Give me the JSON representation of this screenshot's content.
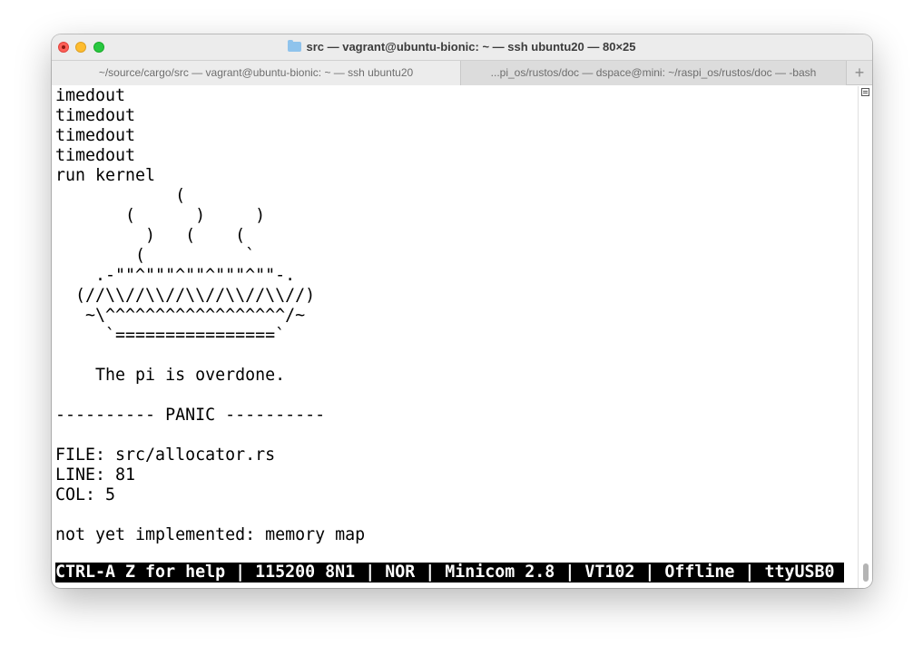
{
  "window": {
    "title": "src — vagrant@ubuntu-bionic: ~ — ssh ubuntu20 — 80×25",
    "folder_icon": "folder-icon"
  },
  "tabs": [
    {
      "label": "~/source/cargo/src — vagrant@ubuntu-bionic: ~ — ssh ubuntu20",
      "active": true
    },
    {
      "label": "...pi_os/rustos/doc — dspace@mini: ~/raspi_os/rustos/doc — -bash",
      "active": false
    }
  ],
  "new_tab_label": "+",
  "terminal": {
    "lines": [
      "imedout",
      "timedout",
      "timedout",
      "timedout",
      "run kernel",
      "            (",
      "       (      )     )",
      "         )   (    (",
      "        (          `",
      "    .-\"\"^\"\"\"^\"\"^\"\"\"^\"\"-.",
      "  (//\\\\//\\\\//\\\\//\\\\//\\\\//)",
      "   ~\\^^^^^^^^^^^^^^^^^^/~",
      "     `================`",
      "",
      "    The pi is overdone.",
      "",
      "---------- PANIC ----------",
      "",
      "FILE: src/allocator.rs",
      "LINE: 81",
      "COL: 5",
      "",
      "not yet implemented: memory map"
    ],
    "status_bar": "CTRL-A Z for help | 115200 8N1 | NOR | Minicom 2.8 | VT102 | Offline | ttyUSB0"
  }
}
